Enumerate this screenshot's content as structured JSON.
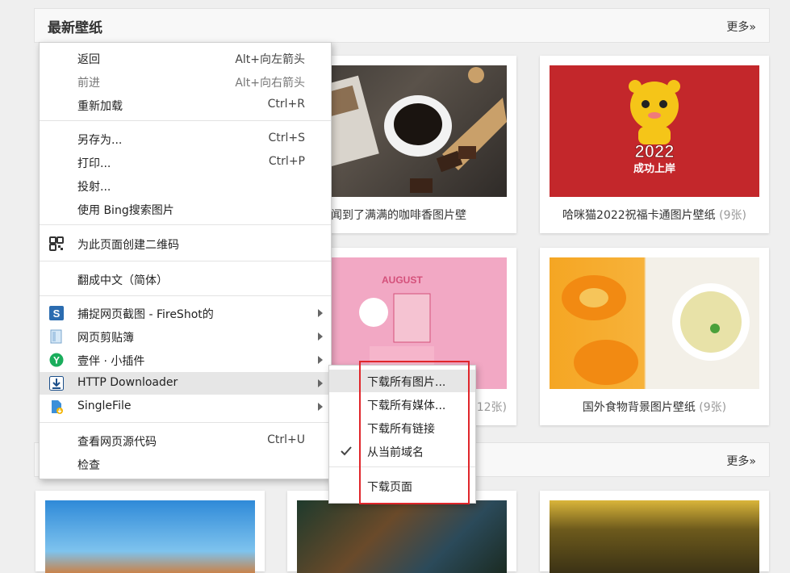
{
  "section1": {
    "title": "最新壁纸",
    "more": "更多»"
  },
  "section2": {
    "more": "更多»"
  },
  "cards": [
    {
      "caption": "浮幕都闻到了满满的咖啡香图片壁",
      "count": ""
    },
    {
      "caption": "哈咪猫2022祝福卡通图片壁纸",
      "count": "(9张)"
    },
    {
      "caption": "",
      "count": "(12张)",
      "image_text": "AUGUST"
    },
    {
      "caption": "国外食物背景图片壁纸",
      "count": "(9张)"
    }
  ],
  "red_card_text": {
    "year": "2022",
    "slogan": "成功上岸"
  },
  "context_menu": {
    "items": [
      {
        "label": "返回",
        "shortcut": "Alt+向左箭头"
      },
      {
        "label": "前进",
        "shortcut": "Alt+向右箭头",
        "disabled": true
      },
      {
        "label": "重新加载",
        "shortcut": "Ctrl+R"
      },
      {
        "label": "另存为...",
        "shortcut": "Ctrl+S"
      },
      {
        "label": "打印...",
        "shortcut": "Ctrl+P"
      },
      {
        "label": "投射...",
        "shortcut": ""
      },
      {
        "label": "使用 Bing搜索图片",
        "shortcut": ""
      },
      {
        "label": "为此页面创建二维码",
        "icon": "qr-code-icon"
      },
      {
        "label": "翻成中文（简体）"
      },
      {
        "label": "捕捉网页截图 - FireShot的",
        "icon": "fireshot-icon"
      },
      {
        "label": "网页剪贴簿",
        "icon": "clipboard-icon"
      },
      {
        "label": "壹伴 · 小插件",
        "icon": "yiban-icon"
      },
      {
        "label": "HTTP Downloader",
        "icon": "download-icon"
      },
      {
        "label": "SingleFile",
        "icon": "singlefile-icon"
      },
      {
        "label": "查看网页源代码",
        "shortcut": "Ctrl+U"
      },
      {
        "label": "检查",
        "shortcut": ""
      }
    ]
  },
  "submenu": {
    "items": [
      {
        "label": "下载所有图片..."
      },
      {
        "label": "下载所有媒体..."
      },
      {
        "label": "下载所有链接"
      },
      {
        "label": "从当前域名",
        "checked": true
      },
      {
        "label": "下载页面"
      }
    ]
  },
  "colors": {
    "highlight_box": "#e0262b",
    "menu_hover": "#e6e6e6"
  }
}
